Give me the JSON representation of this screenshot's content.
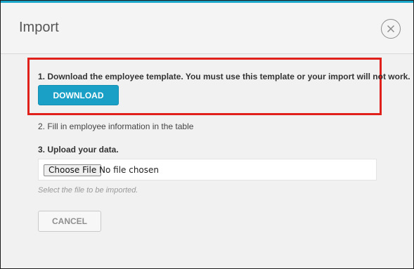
{
  "dialog": {
    "title": "Import",
    "close_icon": "close-x-circle-icon"
  },
  "steps": {
    "step1_text": "1. Download the employee template. You must use this template or your import will not work.",
    "download_label": "DOWNLOAD",
    "step2_text": "2. Fill in employee information in the table",
    "step3_text": "3. Upload your data."
  },
  "file_input": {
    "button_label": "Choose File",
    "status": "No file chosen",
    "hint": "Select the file to be imported."
  },
  "actions": {
    "cancel_label": "CANCEL"
  },
  "colors": {
    "accent": "#1aa0c6",
    "highlight_border": "#e0201b",
    "dialog_bg": "#f1f1f1"
  }
}
